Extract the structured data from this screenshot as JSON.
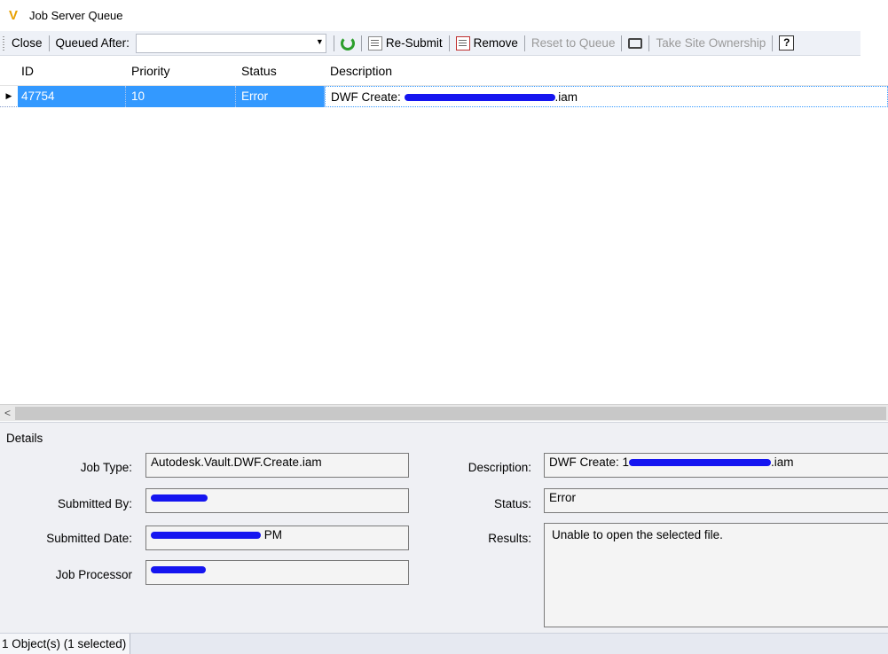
{
  "window": {
    "title": "Job Server Queue",
    "app_icon": "V"
  },
  "toolbar": {
    "close_label": "Close",
    "queued_after_label": "Queued After:",
    "queued_after_value": "",
    "resubmit_label": "Re-Submit",
    "remove_label": "Remove",
    "reset_label": "Reset to Queue",
    "take_ownership_label": "Take Site Ownership",
    "help_label": "?"
  },
  "grid": {
    "columns": [
      "ID",
      "Priority",
      "Status",
      "Description"
    ],
    "rows": [
      {
        "id": "47754",
        "priority": "10",
        "status": "Error",
        "desc_prefix": "DWF Create: ",
        "desc_suffix": ".iam"
      }
    ]
  },
  "scrollbar": {
    "left_arrow": "<"
  },
  "details": {
    "heading": "Details",
    "job_type_label": "Job Type:",
    "job_type_value": "Autodesk.Vault.DWF.Create.iam",
    "submitted_by_label": "Submitted By:",
    "submitted_by_value": "",
    "submitted_date_label": "Submitted Date:",
    "submitted_date_value": "PM",
    "job_processor_label": "Job Processor",
    "job_processor_value": "",
    "description_label": "Description:",
    "description_prefix": "DWF Create: 1",
    "description_suffix": ".iam",
    "status_label": "Status:",
    "status_value": "Error",
    "results_label": "Results:",
    "results_value": "Unable to open the selected file."
  },
  "statusbar": {
    "text": "1 Object(s) (1 selected)"
  },
  "colors": {
    "selection": "#3399ff",
    "redaction": "#1515f0",
    "toolbar_bg": "#eef1f7"
  }
}
